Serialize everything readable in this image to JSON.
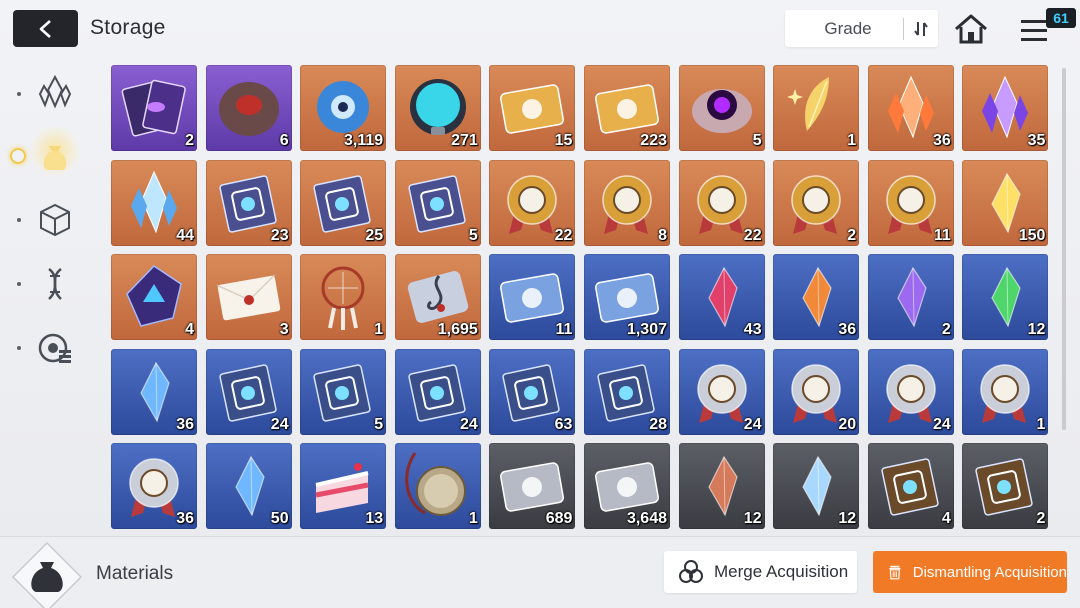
{
  "header": {
    "title": "Storage",
    "sort_label": "Grade",
    "notification_count": "61",
    "icons": [
      "back-arrow-icon",
      "sort-icon",
      "home-icon",
      "menu-icon"
    ]
  },
  "sidebar": {
    "items": [
      {
        "name": "crystal-icon",
        "active": false
      },
      {
        "name": "pouch-icon",
        "active": true
      },
      {
        "name": "cube-icon",
        "active": false
      },
      {
        "name": "dna-icon",
        "active": false
      },
      {
        "name": "target-list-icon",
        "active": false
      }
    ]
  },
  "grid": {
    "items": [
      {
        "name": "purple-cards",
        "grade": "purple",
        "qty": "2"
      },
      {
        "name": "red-core-rock",
        "grade": "purple",
        "qty": "6"
      },
      {
        "name": "blue-eye-orb",
        "grade": "orange",
        "qty": "3,119"
      },
      {
        "name": "cyan-sphere-device",
        "grade": "orange",
        "qty": "271"
      },
      {
        "name": "gold-id-ticket",
        "grade": "orange",
        "qty": "15"
      },
      {
        "name": "gold-star-ticket",
        "grade": "orange",
        "qty": "223"
      },
      {
        "name": "purple-eye-creature",
        "grade": "orange",
        "qty": "5"
      },
      {
        "name": "gold-feather",
        "grade": "orange",
        "qty": "1"
      },
      {
        "name": "orange-crystal",
        "grade": "orange",
        "qty": "36"
      },
      {
        "name": "purple-crystal",
        "grade": "orange",
        "qty": "35"
      },
      {
        "name": "blue-crystal",
        "grade": "orange",
        "qty": "44"
      },
      {
        "name": "book-swords",
        "grade": "orange",
        "qty": "23"
      },
      {
        "name": "book-eye",
        "grade": "orange",
        "qty": "25"
      },
      {
        "name": "book-bolt",
        "grade": "orange",
        "qty": "5"
      },
      {
        "name": "gold-medal-swords",
        "grade": "orange",
        "qty": "22"
      },
      {
        "name": "gold-medal-shield",
        "grade": "orange",
        "qty": "8"
      },
      {
        "name": "gold-medal-eye",
        "grade": "orange",
        "qty": "22"
      },
      {
        "name": "gold-medal-bolt",
        "grade": "orange",
        "qty": "2"
      },
      {
        "name": "gold-medal-cross",
        "grade": "orange",
        "qty": "11"
      },
      {
        "name": "yellow-shards",
        "grade": "orange",
        "qty": "150"
      },
      {
        "name": "dark-cube",
        "grade": "orange",
        "qty": "4"
      },
      {
        "name": "envelope",
        "grade": "orange",
        "qty": "3"
      },
      {
        "name": "dreamcatcher",
        "grade": "orange",
        "qty": "1"
      },
      {
        "name": "music-note",
        "grade": "orange",
        "qty": "1,695"
      },
      {
        "name": "blue-id-ticket",
        "grade": "blue",
        "qty": "11"
      },
      {
        "name": "blue-star-ticket",
        "grade": "blue",
        "qty": "1,307"
      },
      {
        "name": "red-gem",
        "grade": "blue",
        "qty": "43"
      },
      {
        "name": "orange-gem",
        "grade": "blue",
        "qty": "36"
      },
      {
        "name": "violet-gem",
        "grade": "blue",
        "qty": "2"
      },
      {
        "name": "green-gem",
        "grade": "blue",
        "qty": "12"
      },
      {
        "name": "blue-shard-gem",
        "grade": "blue",
        "qty": "36"
      },
      {
        "name": "blue-book-swords",
        "grade": "blue",
        "qty": "24"
      },
      {
        "name": "blue-book-shield",
        "grade": "blue",
        "qty": "5"
      },
      {
        "name": "blue-book-eye",
        "grade": "blue",
        "qty": "24"
      },
      {
        "name": "blue-book-bolt",
        "grade": "blue",
        "qty": "63"
      },
      {
        "name": "blue-book-cross",
        "grade": "blue",
        "qty": "28"
      },
      {
        "name": "silver-medal-swords",
        "grade": "blue",
        "qty": "24"
      },
      {
        "name": "silver-medal-shield",
        "grade": "blue",
        "qty": "20"
      },
      {
        "name": "silver-medal-eye",
        "grade": "blue",
        "qty": "24"
      },
      {
        "name": "silver-medal-bolt",
        "grade": "blue",
        "qty": "1"
      },
      {
        "name": "silver-medal-cross",
        "grade": "blue",
        "qty": "36"
      },
      {
        "name": "blue-comet-gem",
        "grade": "blue",
        "qty": "50"
      },
      {
        "name": "cake-slice",
        "grade": "blue",
        "qty": "13"
      },
      {
        "name": "pocket-watch",
        "grade": "blue",
        "qty": "1"
      },
      {
        "name": "gray-id-ticket",
        "grade": "gray",
        "qty": "689"
      },
      {
        "name": "gray-star-ticket",
        "grade": "gray",
        "qty": "3,648"
      },
      {
        "name": "copper-gem",
        "grade": "gray",
        "qty": "12"
      },
      {
        "name": "pale-blue-gem",
        "grade": "gray",
        "qty": "12"
      },
      {
        "name": "brown-book-swords",
        "grade": "gray",
        "qty": "4"
      },
      {
        "name": "brown-book-shield",
        "grade": "gray",
        "qty": "2"
      }
    ]
  },
  "footer": {
    "category_label": "Materials",
    "merge_label": "Merge Acquisition",
    "dismantle_label": "Dismantling Acquisition"
  },
  "colors": {
    "accent_orange": "#f07a26",
    "grade_orange": "#c9744a",
    "grade_purple": "#7350bd",
    "grade_blue": "#3b5bb0",
    "grade_gray": "#4a4c52"
  }
}
